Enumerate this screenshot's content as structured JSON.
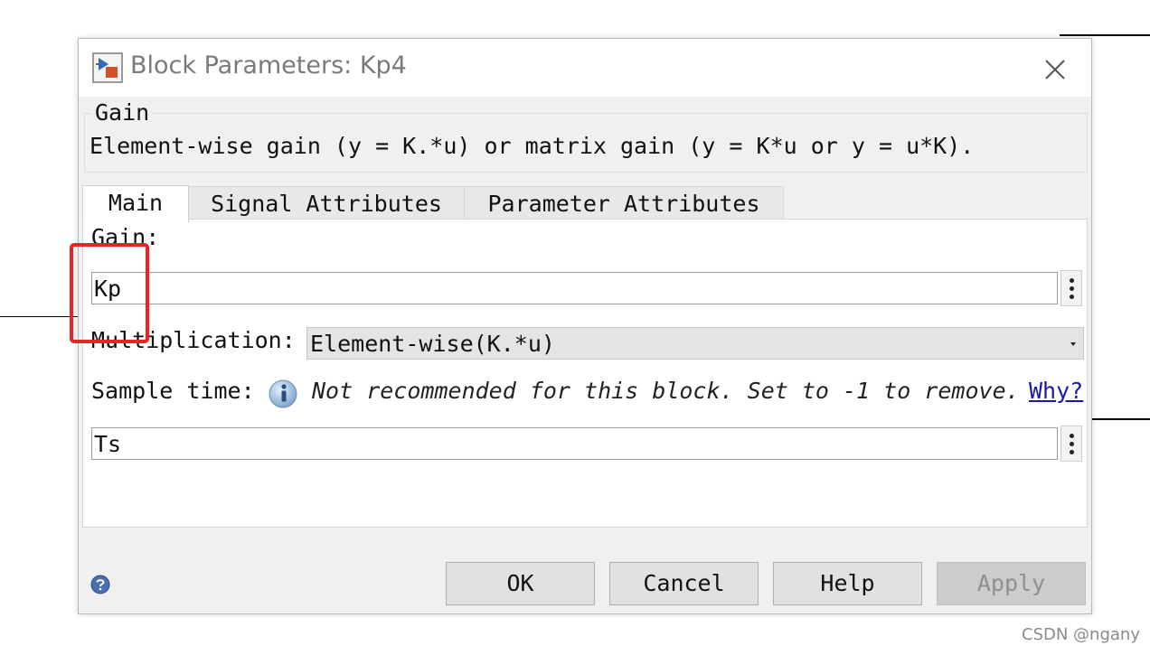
{
  "window": {
    "title": "Block Parameters: Kp4"
  },
  "group": {
    "title": "Gain",
    "description": "Element-wise gain (y = K.*u) or matrix gain (y = K*u or y = u*K)."
  },
  "tabs": [
    {
      "label": "Main",
      "active": true
    },
    {
      "label": "Signal Attributes",
      "active": false
    },
    {
      "label": "Parameter Attributes",
      "active": false
    }
  ],
  "main": {
    "gain_label": "Gain:",
    "gain_value": "Kp",
    "multiplication_label": "Multiplication:",
    "multiplication_value": "Element-wise(K.*u)",
    "sample_time_label": "Sample time:",
    "sample_time_note": "Not recommended for this block. Set to -1 to remove.",
    "why_link": "Why?",
    "sample_time_value": "Ts"
  },
  "buttons": {
    "ok": "OK",
    "cancel": "Cancel",
    "help": "Help",
    "apply": "Apply"
  },
  "icons": {
    "app": "simulink-block-icon",
    "close": "close-icon",
    "info": "info-icon",
    "help": "help-icon",
    "more": "kebab-menu-icon"
  },
  "colors": {
    "highlight": "#ee2222",
    "link": "#1a1aa6"
  },
  "watermark": "CSDN @ngany"
}
